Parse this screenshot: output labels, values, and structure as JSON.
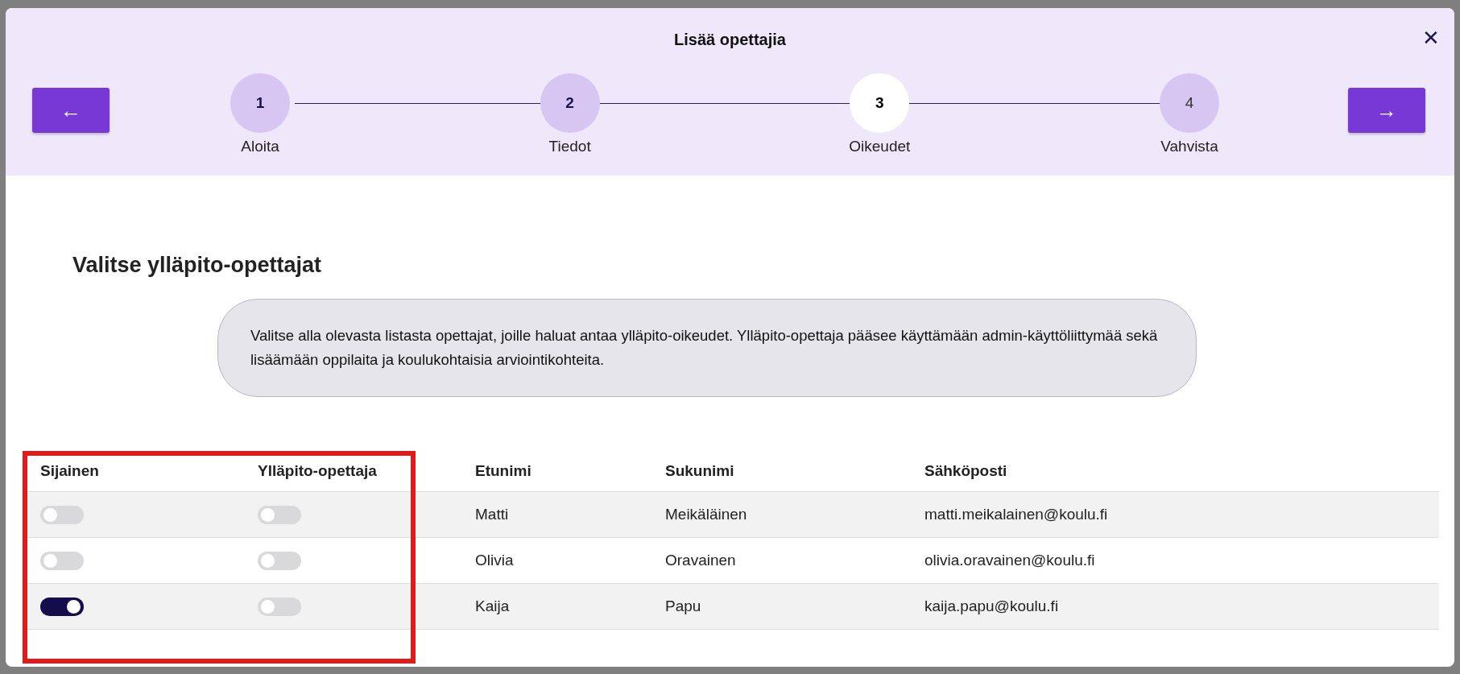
{
  "dialog": {
    "title": "Lisää opettajia",
    "close": "✕",
    "prev": "←",
    "next": "→"
  },
  "steps": [
    {
      "number": "1",
      "label": "Aloita",
      "kind": "done"
    },
    {
      "number": "2",
      "label": "Tiedot",
      "kind": "done"
    },
    {
      "number": "3",
      "label": "Oikeudet",
      "kind": "current"
    },
    {
      "number": "4",
      "label": "Vahvista",
      "kind": "upcoming"
    }
  ],
  "heading": "Valitse ylläpito-opettajat",
  "info": "Valitse alla olevasta listasta opettajat, joille haluat antaa ylläpito-oikeudet. Ylläpito-opettaja pääsee käyttämään admin-käyttöliittymää sekä lisäämään oppilaita ja koulukohtaisia arviointikohteita.",
  "table": {
    "columns": [
      "Sijainen",
      "Ylläpito-opettaja",
      "Etunimi",
      "Sukunimi",
      "Sähköposti"
    ],
    "rows": [
      {
        "substitute": false,
        "admin": false,
        "first": "Matti",
        "last": "Meikäläinen",
        "email": "matti.meikalainen@koulu.fi"
      },
      {
        "substitute": false,
        "admin": false,
        "first": "Olivia",
        "last": "Oravainen",
        "email": "olivia.oravainen@koulu.fi"
      },
      {
        "substitute": true,
        "admin": false,
        "first": "Kaija",
        "last": "Papu",
        "email": "kaija.papu@koulu.fi"
      }
    ]
  }
}
